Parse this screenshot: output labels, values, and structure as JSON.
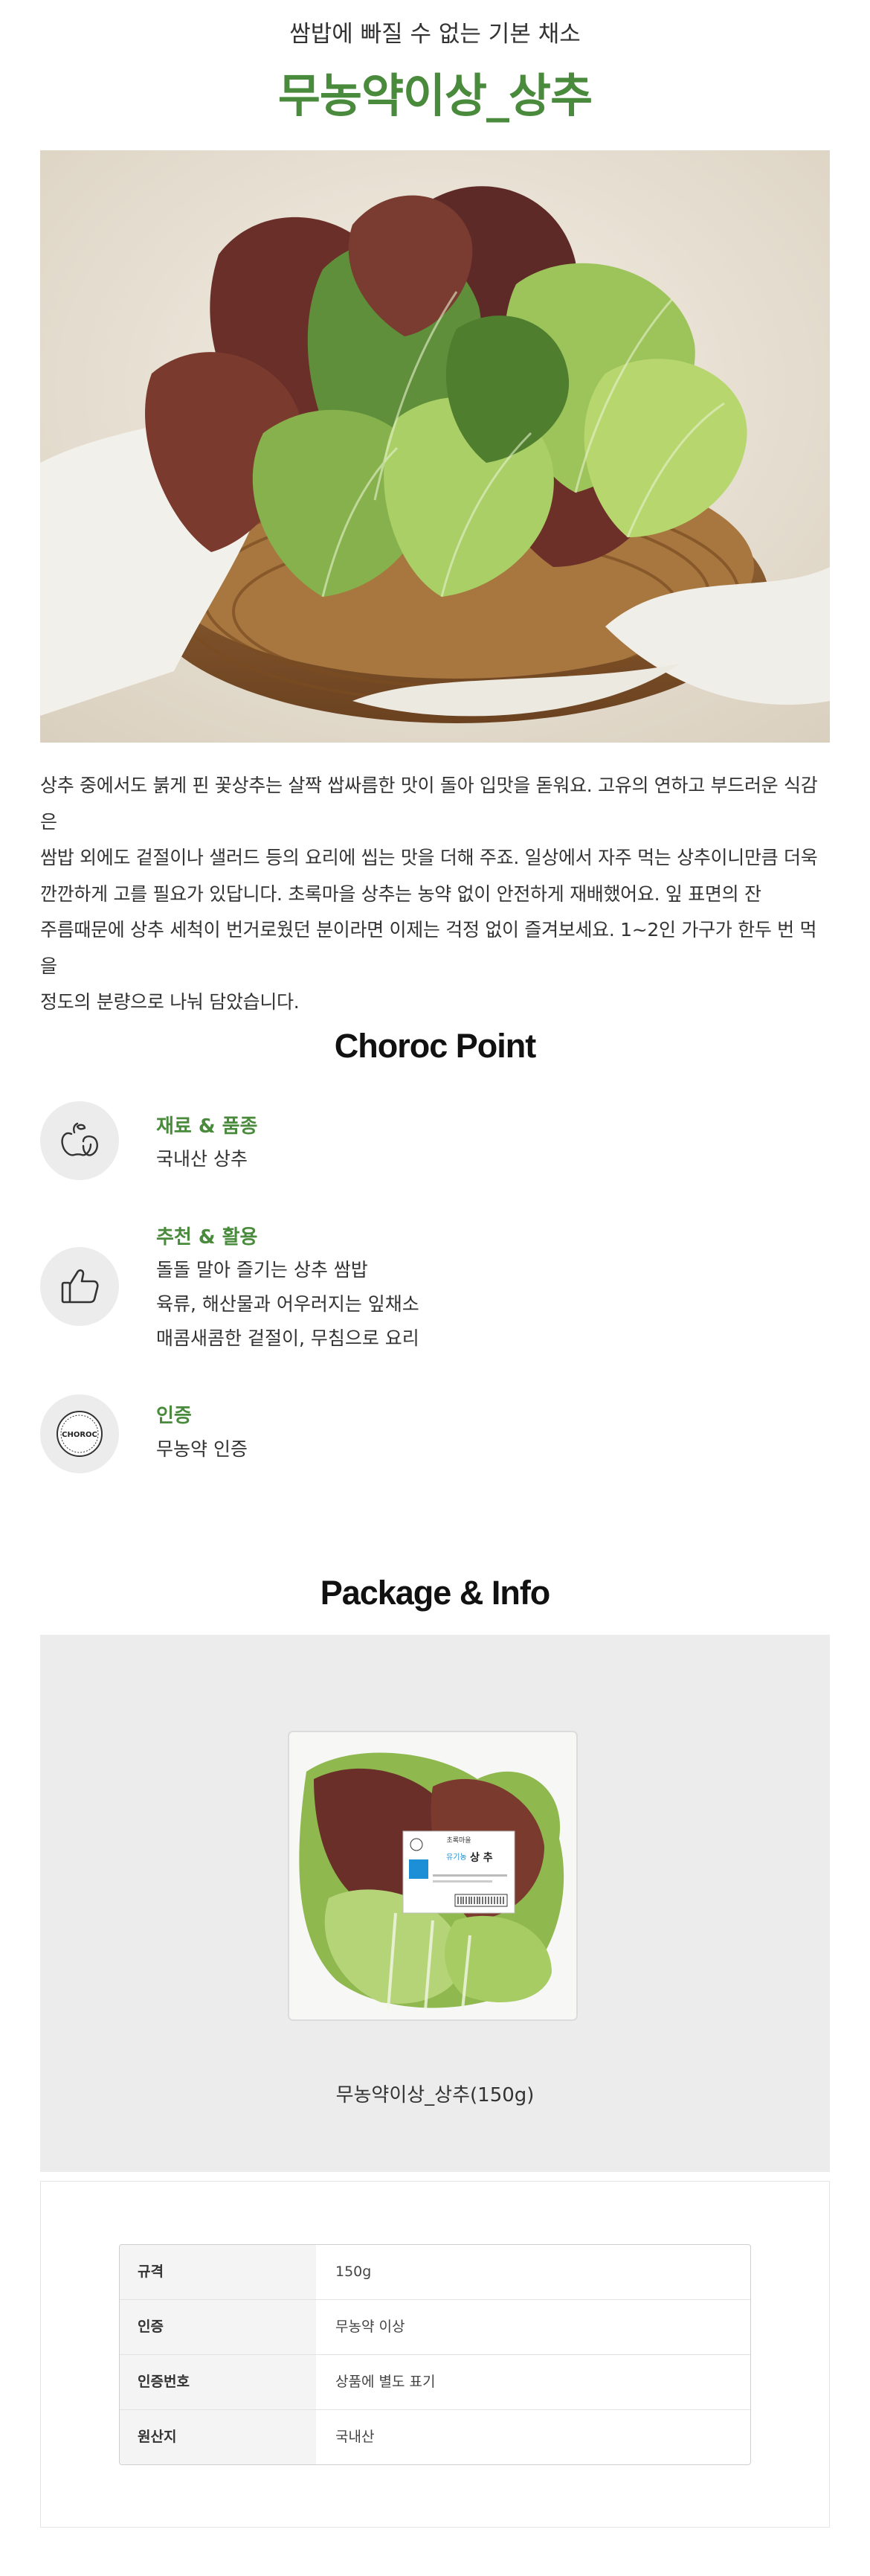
{
  "header": {
    "subtitle": "쌈밥에 빠질 수 없는 기본 채소",
    "title": "무농약이상_상추"
  },
  "description": [
    "상추 중에서도 붉게 핀 꽃상추는 살짝 쌉싸름한 맛이 돌아 입맛을 돋워요. 고유의 연하고 부드러운 식감은",
    "쌈밥 외에도 겉절이나 샐러드 등의 요리에 씹는 맛을 더해 주죠. 일상에서 자주 먹는 상추이니만큼 더욱",
    "깐깐하게 고를 필요가 있답니다. 초록마을 상추는 농약 없이 안전하게 재배했어요. 잎 표면의 잔",
    "주름때문에 상추 세척이 번거로웠던 분이라면 이제는 걱정 없이 즐겨보세요. 1~2인 가구가 한두 번 먹을",
    "정도의 분량으로 나눠 담았습니다."
  ],
  "point": {
    "title": "Choroc Point",
    "items": [
      {
        "icon": "apple-icon",
        "heading": "재료 & 품종",
        "lines": [
          "국내산 상추"
        ]
      },
      {
        "icon": "thumbs-up-icon",
        "heading": "추천 & 활용",
        "lines": [
          "돌돌 말아 즐기는 상추 쌈밥",
          "육류, 해산물과 어우러지는 잎채소",
          "매콤새콤한 겉절이, 무침으로 요리"
        ]
      },
      {
        "icon": "choroc-seal-icon",
        "heading": "인증",
        "lines": [
          "무농약 인증"
        ]
      }
    ],
    "seal_text": "CHOROC"
  },
  "package": {
    "title": "Package & Info",
    "caption": "무농약이상_상추(150g)",
    "label_brand": "초록마을",
    "label_cert": "유기농",
    "label_name": "상 추"
  },
  "info": {
    "rows": [
      {
        "label": "규격",
        "value": "150g"
      },
      {
        "label": "인증",
        "value": "무농약 이상"
      },
      {
        "label": "인증번호",
        "value": "상품에 별도 표기"
      },
      {
        "label": "원산지",
        "value": "국내산"
      }
    ]
  },
  "colors": {
    "accent_green": "#4a8a3c",
    "panel_gray": "#ececec"
  }
}
